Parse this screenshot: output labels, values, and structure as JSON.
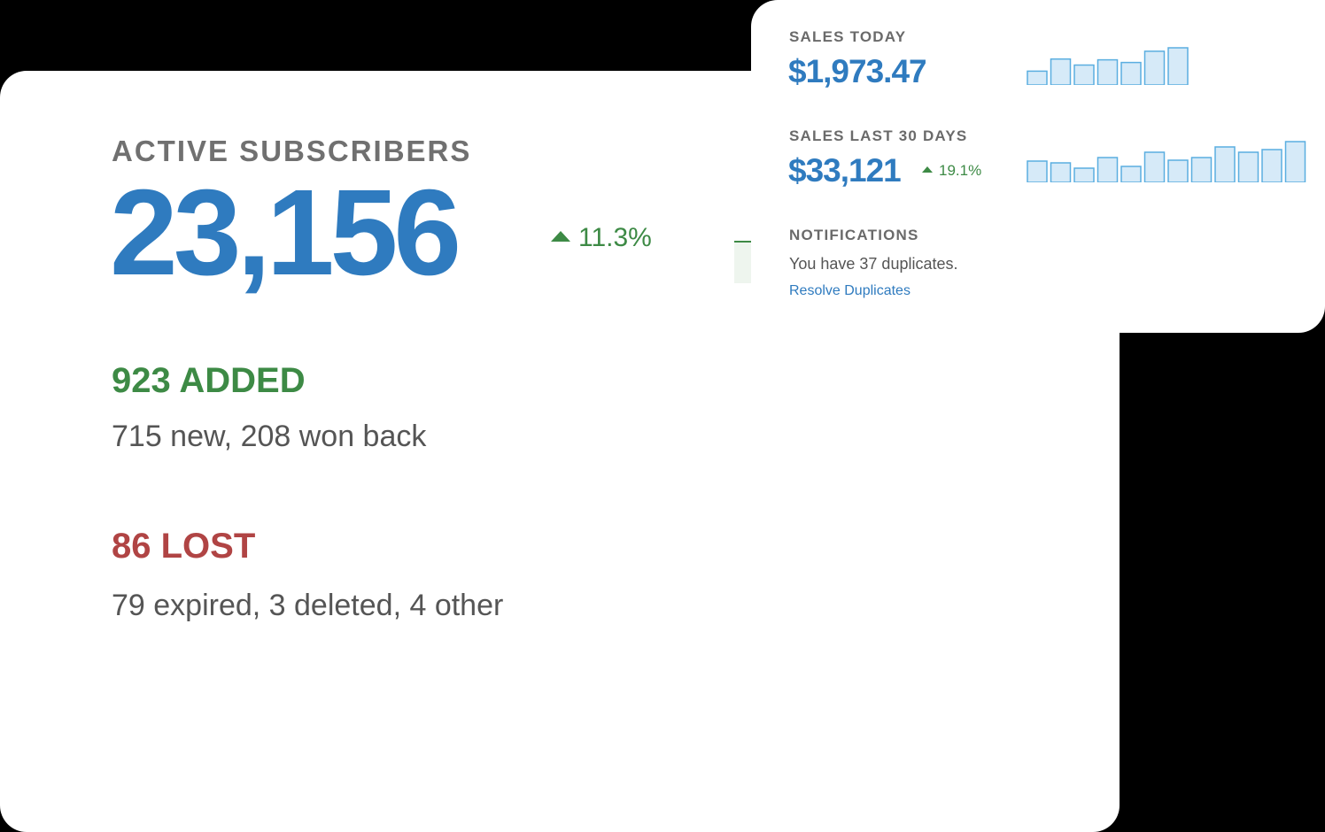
{
  "subscribers": {
    "title": "ACTIVE SUBSCRIBERS",
    "value": "23,156",
    "delta": "11.3%",
    "added": {
      "title": "923 ADDED",
      "detail": "715 new, 208 won back"
    },
    "lost": {
      "title": "86 LOST",
      "detail": "79 expired, 3 deleted, 4 other"
    }
  },
  "sales_today": {
    "label": "SALES TODAY",
    "value": "$1,973.47"
  },
  "sales_30": {
    "label": "SALES LAST 30 DAYS",
    "value": "$33,121",
    "delta": "19.1%"
  },
  "notifications": {
    "label": "NOTIFICATIONS",
    "text": "You have 37 duplicates.",
    "link": "Resolve Duplicates"
  },
  "colors": {
    "accent_blue": "#2f7bbf",
    "positive_green": "#3d8a45",
    "negative_red": "#b04444",
    "bar_fill": "#d6eaf8",
    "bar_stroke": "#5aaee0"
  },
  "chart_data": [
    {
      "type": "bar",
      "chart": "sales-today-sparkline",
      "values": [
        16,
        30,
        23,
        29,
        26,
        39,
        43
      ],
      "ylim": [
        0,
        45
      ]
    },
    {
      "type": "bar",
      "chart": "sales-30-days-sparkline",
      "values": [
        24,
        22,
        16,
        28,
        18,
        34,
        25,
        28,
        40,
        34,
        37,
        46
      ],
      "ylim": [
        0,
        48
      ]
    }
  ]
}
